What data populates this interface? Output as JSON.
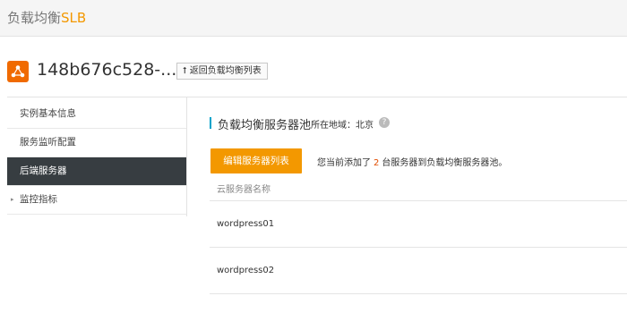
{
  "brand": {
    "prefix": "负载均衡",
    "accent": "SLB",
    "accent_color": "#f39800"
  },
  "instance": {
    "title": "148b676c528-...",
    "back_label": "返回负载均衡列表",
    "back_icon": "up-arrow-icon"
  },
  "sidebar": {
    "items": [
      {
        "label": "实例基本信息",
        "active": false
      },
      {
        "label": "服务监听配置",
        "active": false
      },
      {
        "label": "后端服务器",
        "active": true
      },
      {
        "label": "监控指标",
        "active": false,
        "caret": "▸"
      }
    ]
  },
  "section": {
    "title": "负载均衡服务器池",
    "region": "所在地域：北京",
    "help_icon": "?"
  },
  "toolbar": {
    "edit_label": "编辑服务器列表"
  },
  "notice": {
    "before": "您当前添加了",
    "count": "2",
    "after": "台服务器到负载均衡服务器池。"
  },
  "table": {
    "header": "云服务器名称",
    "rows": [
      {
        "name": "wordpress01"
      },
      {
        "name": "wordpress02"
      }
    ]
  }
}
